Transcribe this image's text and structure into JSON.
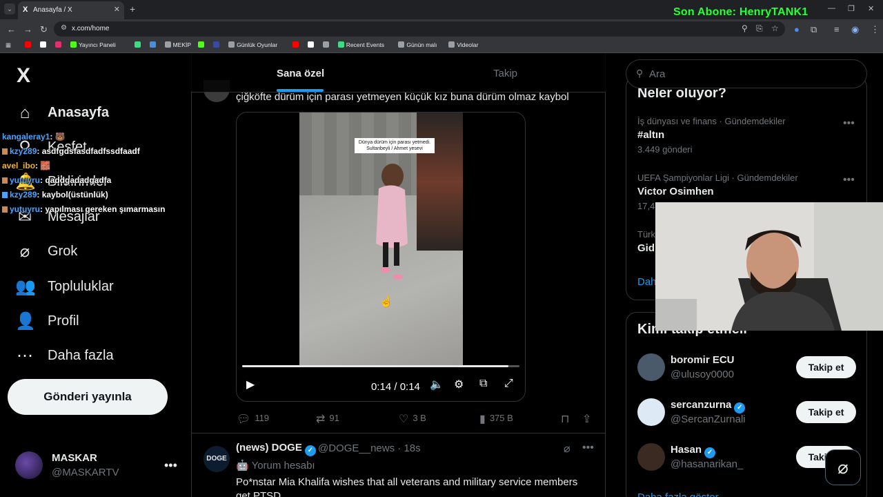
{
  "browser": {
    "tab_title": "Anasayfa / X",
    "tab_favicon": "X",
    "url": "x.com/home",
    "stream_banner": "Son Abone: HenryTANK1",
    "bookmarks": [
      {
        "label": "",
        "color": "#ff0000"
      },
      {
        "label": "",
        "color": "#ffffff"
      },
      {
        "label": "",
        "color": "#e1306c"
      },
      {
        "label": "Yayıncı Paneli",
        "color": "#53fc18"
      },
      {
        "label": "",
        "color": "#3ddc84"
      },
      {
        "label": "",
        "color": "#4a90d9"
      },
      {
        "label": "MEKİP",
        "color": "#9aa0a6"
      },
      {
        "label": "",
        "color": "#53fc18"
      },
      {
        "label": "",
        "color": "#3949ab"
      },
      {
        "label": "Günlük Oyunlar",
        "color": "#9aa0a6"
      },
      {
        "label": "",
        "color": "#ff0000"
      },
      {
        "label": "",
        "color": "#ffffff"
      },
      {
        "label": "",
        "color": "#9aa0a6"
      },
      {
        "label": "Recent Events",
        "color": "#3ddc84"
      },
      {
        "label": "Günün malı",
        "color": "#9aa0a6"
      },
      {
        "label": "Videolar",
        "color": "#9aa0a6"
      }
    ]
  },
  "sidebar": {
    "logo": "X",
    "items": [
      {
        "label": "Anasayfa",
        "icon": "home-icon",
        "glyph": "⌂"
      },
      {
        "label": "Keşfet",
        "icon": "search-icon",
        "glyph": "⚲"
      },
      {
        "label": "Bildirimler",
        "icon": "bell-icon",
        "glyph": "🔔"
      },
      {
        "label": "Mesajlar",
        "icon": "mail-icon",
        "glyph": "✉"
      },
      {
        "label": "Grok",
        "icon": "grok-icon",
        "glyph": "⌀"
      },
      {
        "label": "Topluluklar",
        "icon": "communities-icon",
        "glyph": "👥"
      },
      {
        "label": "Profil",
        "icon": "person-icon",
        "glyph": "👤"
      },
      {
        "label": "Daha fazla",
        "icon": "more-circle-icon",
        "glyph": "⋯"
      }
    ],
    "post_button": "Gönderi yayınla",
    "user": {
      "name": "MASKAR",
      "handle": "@MASKARTV"
    }
  },
  "chat": [
    {
      "user": "kangaleray1",
      "message": ": 🐻",
      "color": "#4aa3ff"
    },
    {
      "user": "kzy289",
      "message": ": asdfgdsfasdfadfssdfaadf",
      "color": "#4aa3ff"
    },
    {
      "user": "avel_ibo",
      "message": ": 🧱",
      "color": "#f0b429"
    },
    {
      "user": "yutuyru",
      "message": ": qaddgadadgadfa",
      "color": "#4aa3ff"
    },
    {
      "user": "kzy289",
      "message": ": kaybol(üstünlük)",
      "color": "#4aa3ff"
    },
    {
      "user": "yutuyru",
      "message": ": yapılması gereken şımarmasın",
      "color": "#4aa3ff"
    }
  ],
  "feed": {
    "tabs": [
      "Sana özel",
      "Takip"
    ],
    "post1": {
      "text": "çiğköfte dürüm için parası yetmeyen küçük kız buna dürüm olmaz kaybol",
      "video_caption": "Dünya dürüm için parası yetmedi. Sultanbeyli / Ahmet yesevi",
      "time": "0:14 / 0:14",
      "progress": 0.96,
      "replies": "119",
      "reposts": "91",
      "likes": "3 B",
      "views": "375 B"
    },
    "post2": {
      "name": "(news) DOGE",
      "handle": "@DOGE__news · 18s",
      "sub": "🤖 Yorum hesabı",
      "text": "Po*nstar Mia Khalifa wishes that all veterans and military service members get PTSD",
      "avatar_text": "DOGE"
    }
  },
  "right": {
    "search_placeholder": "Ara",
    "trends_title": "Neler oluyor?",
    "trends": [
      {
        "category": "İş dünyası ve finans · Gündemdekiler",
        "name": "#altın",
        "count": "3.449 gönderi"
      },
      {
        "category": "UEFA Şampiyonlar Ligi · Gündemdekiler",
        "name": "Victor Osimhen",
        "count": "17,4"
      },
      {
        "category": "Türk",
        "name": "Gid",
        "count": ""
      }
    ],
    "trends_more": "Dah",
    "who_title": "Kimi takip etmeli",
    "who": [
      {
        "name": "boromir ECU",
        "handle": "@ulusoy0000",
        "verified": false,
        "button": "Takip et",
        "avatar_color": "#4b5a6a"
      },
      {
        "name": "sercanzurna",
        "handle": "@SercanZurnali",
        "verified": true,
        "button": "Takip et",
        "avatar_color": "#dde9f5"
      },
      {
        "name": "Hasan",
        "handle": "@hasanarikan_",
        "verified": true,
        "button": "Takip et",
        "avatar_color": "#3a2a22"
      }
    ],
    "who_more": "Daha fazla göster"
  }
}
